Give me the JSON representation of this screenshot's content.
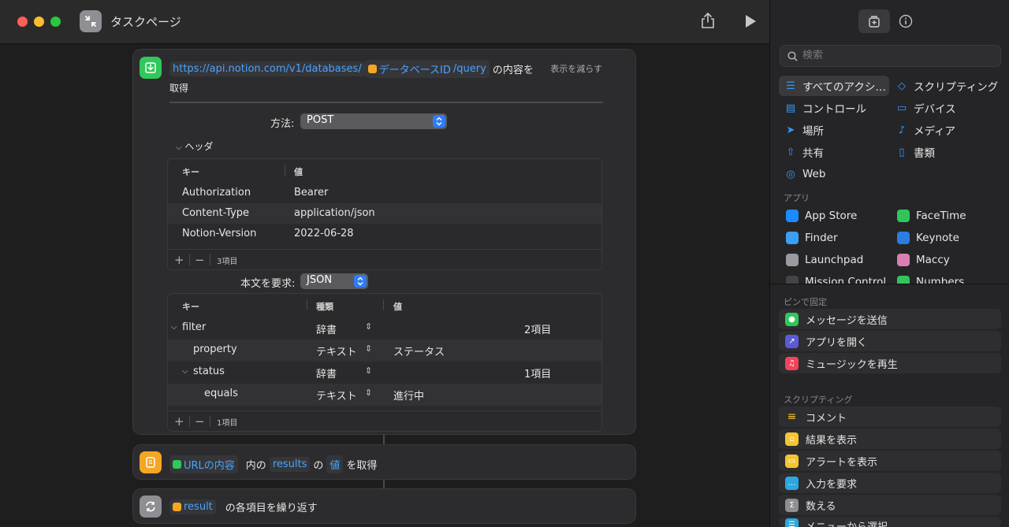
{
  "window": {
    "title": "タスクページ"
  },
  "action1": {
    "url_text": "https://api.notion.com/v1/databases/",
    "variable_label": "データベースID",
    "query_text": "/query",
    "suffix": "の内容を",
    "second_line": "取得",
    "show_less": "表示を減らす",
    "method_label": "方法:",
    "method_value": "POST",
    "headers_toggle": "ヘッダ",
    "headers_cols": [
      "キー",
      "値"
    ],
    "headers": [
      {
        "key": "Authorization",
        "value": "Bearer"
      },
      {
        "key": "Content-Type",
        "value": "application/json"
      },
      {
        "key": "Notion-Version",
        "value": "2022-06-28"
      }
    ],
    "headers_count": "3項目",
    "body_label": "本文を要求:",
    "body_value": "JSON",
    "body_cols": [
      "キー",
      "種類",
      "値"
    ],
    "body_rows": [
      {
        "key": "filter",
        "type": "辞書",
        "value": "",
        "count": "2項目"
      },
      {
        "key": "property",
        "type": "テキスト",
        "value": "ステータス",
        "count": ""
      },
      {
        "key": "status",
        "type": "辞書",
        "value": "",
        "count": "1項目"
      },
      {
        "key": "equals",
        "type": "テキスト",
        "value": "進行中",
        "count": ""
      }
    ],
    "body_count": "1項目"
  },
  "action2": {
    "var_label": "URLの内容",
    "mid1": "内の",
    "key_label": "results",
    "mid2": "の",
    "val_label": "値",
    "suffix": "を取得"
  },
  "action3": {
    "var_label": "result",
    "suffix": "の各項目を繰り返す"
  },
  "sidebar": {
    "search_placeholder": "検索",
    "categories": [
      {
        "label": "すべてのアクシ…",
        "icon": "list-icon"
      },
      {
        "label": "スクリプティング",
        "icon": "script-icon"
      },
      {
        "label": "コントロール",
        "icon": "toggle-icon"
      },
      {
        "label": "デバイス",
        "icon": "display-icon"
      },
      {
        "label": "場所",
        "icon": "location-icon"
      },
      {
        "label": "メディア",
        "icon": "music-icon"
      },
      {
        "label": "共有",
        "icon": "share-icon"
      },
      {
        "label": "書類",
        "icon": "document-icon"
      },
      {
        "label": "Web",
        "icon": "compass-icon"
      }
    ],
    "apps_label": "アプリ",
    "apps": [
      {
        "label": "App Store",
        "color": "#1a8cff"
      },
      {
        "label": "FaceTime",
        "color": "#2fc55a"
      },
      {
        "label": "Finder",
        "color": "#3aa0f5"
      },
      {
        "label": "Keynote",
        "color": "#2a7de1"
      },
      {
        "label": "Launchpad",
        "color": "#9a9aa0"
      },
      {
        "label": "Maccy",
        "color": "#d980b0"
      },
      {
        "label": "Mission Control",
        "color": "#444448"
      },
      {
        "label": "Numbers",
        "color": "#2fc55a"
      }
    ],
    "pinned_label": "ピンで固定",
    "pinned": [
      {
        "label": "メッセージを送信",
        "color": "#30c85a"
      },
      {
        "label": "アプリを開く",
        "color": "#5b5bd6"
      },
      {
        "label": "ミュージックを再生",
        "color": "#f0445a"
      }
    ],
    "scripting_label": "スクリプティング",
    "scripting": [
      {
        "label": "コメント",
        "color": "#f5c531"
      },
      {
        "label": "結果を表示",
        "color": "#f5c531"
      },
      {
        "label": "アラートを表示",
        "color": "#f5c531"
      },
      {
        "label": "入力を要求",
        "color": "#2aa8e0"
      },
      {
        "label": "数える",
        "color": "#8e8e93"
      },
      {
        "label": "メニューから選択",
        "color": "#2aa8e0"
      }
    ]
  }
}
